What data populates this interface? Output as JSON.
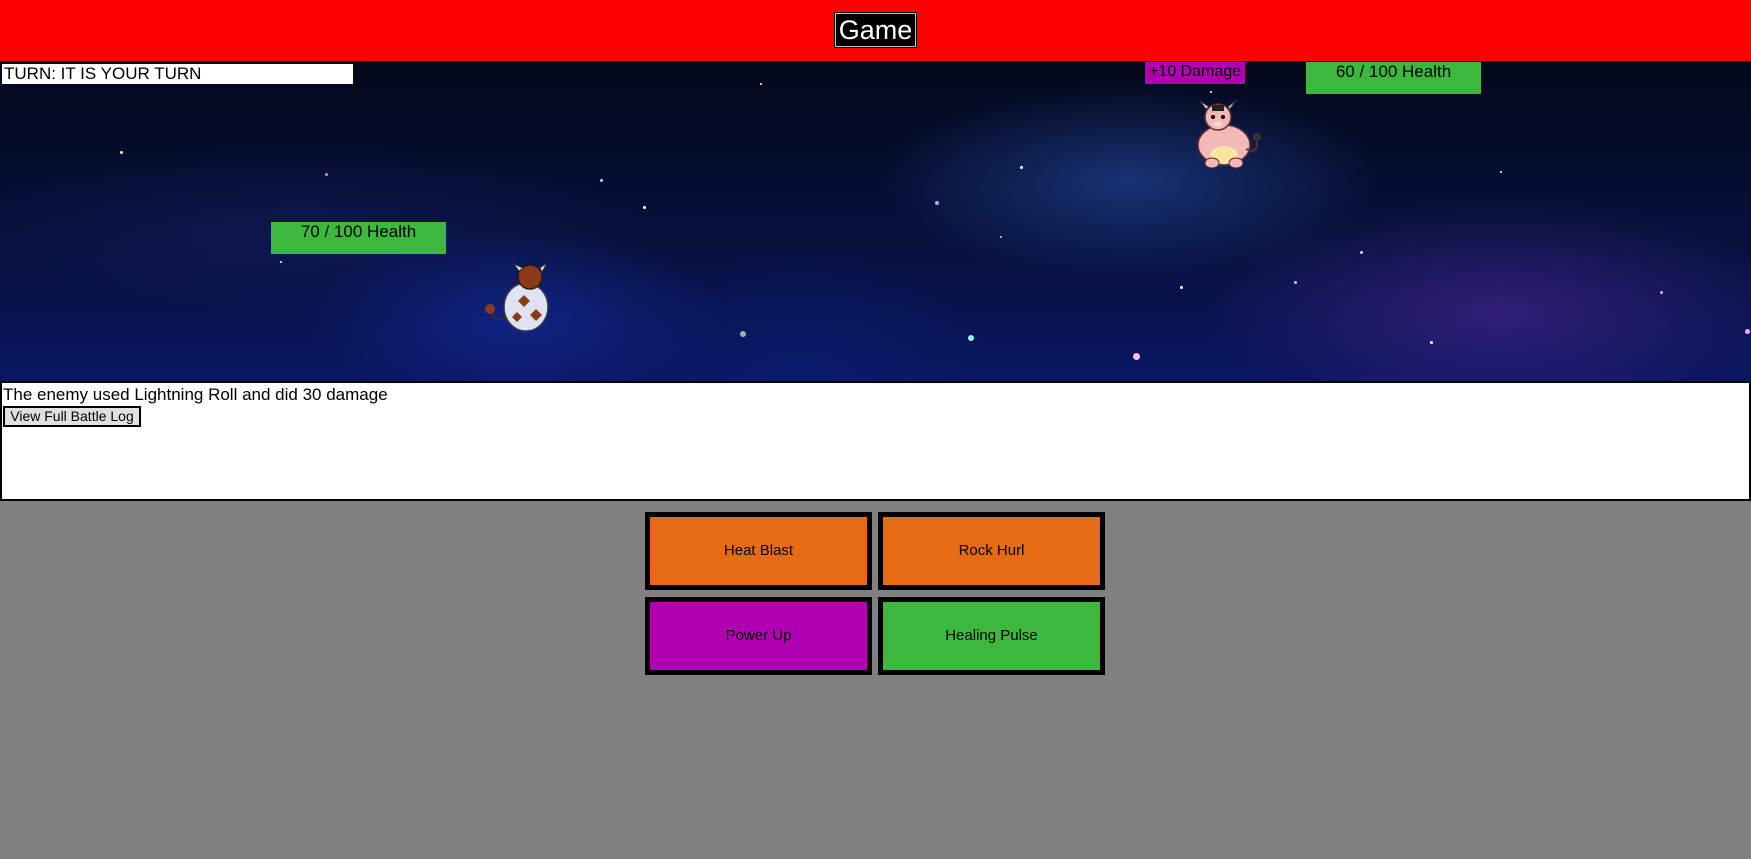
{
  "header": {
    "title": "Game",
    "background": "#ff0000"
  },
  "battle": {
    "turn_text": "TURN: IT IS YOUR TURN",
    "player": {
      "health_label": "70 / 100 Health",
      "health_current": 70,
      "health_max": 100,
      "sprite": "cow-creature-back-icon"
    },
    "enemy": {
      "health_label": "60 / 100 Health",
      "health_current": 60,
      "health_max": 100,
      "status_badge": "+10 Damage",
      "sprite": "cow-creature-front-icon"
    }
  },
  "log": {
    "message": "The enemy used Lightning Roll and did 30 damage",
    "view_full_label": "View Full Battle Log"
  },
  "moves": [
    {
      "label": "Heat Blast",
      "color": "#e56c14"
    },
    {
      "label": "Rock Hurl",
      "color": "#e56c14"
    },
    {
      "label": "Power Up",
      "color": "#b000b0"
    },
    {
      "label": "Healing Pulse",
      "color": "#3cb93c"
    }
  ],
  "colors": {
    "health_bar": "#3cb93c",
    "damage_badge": "#b000b0",
    "page_background": "#808080"
  }
}
